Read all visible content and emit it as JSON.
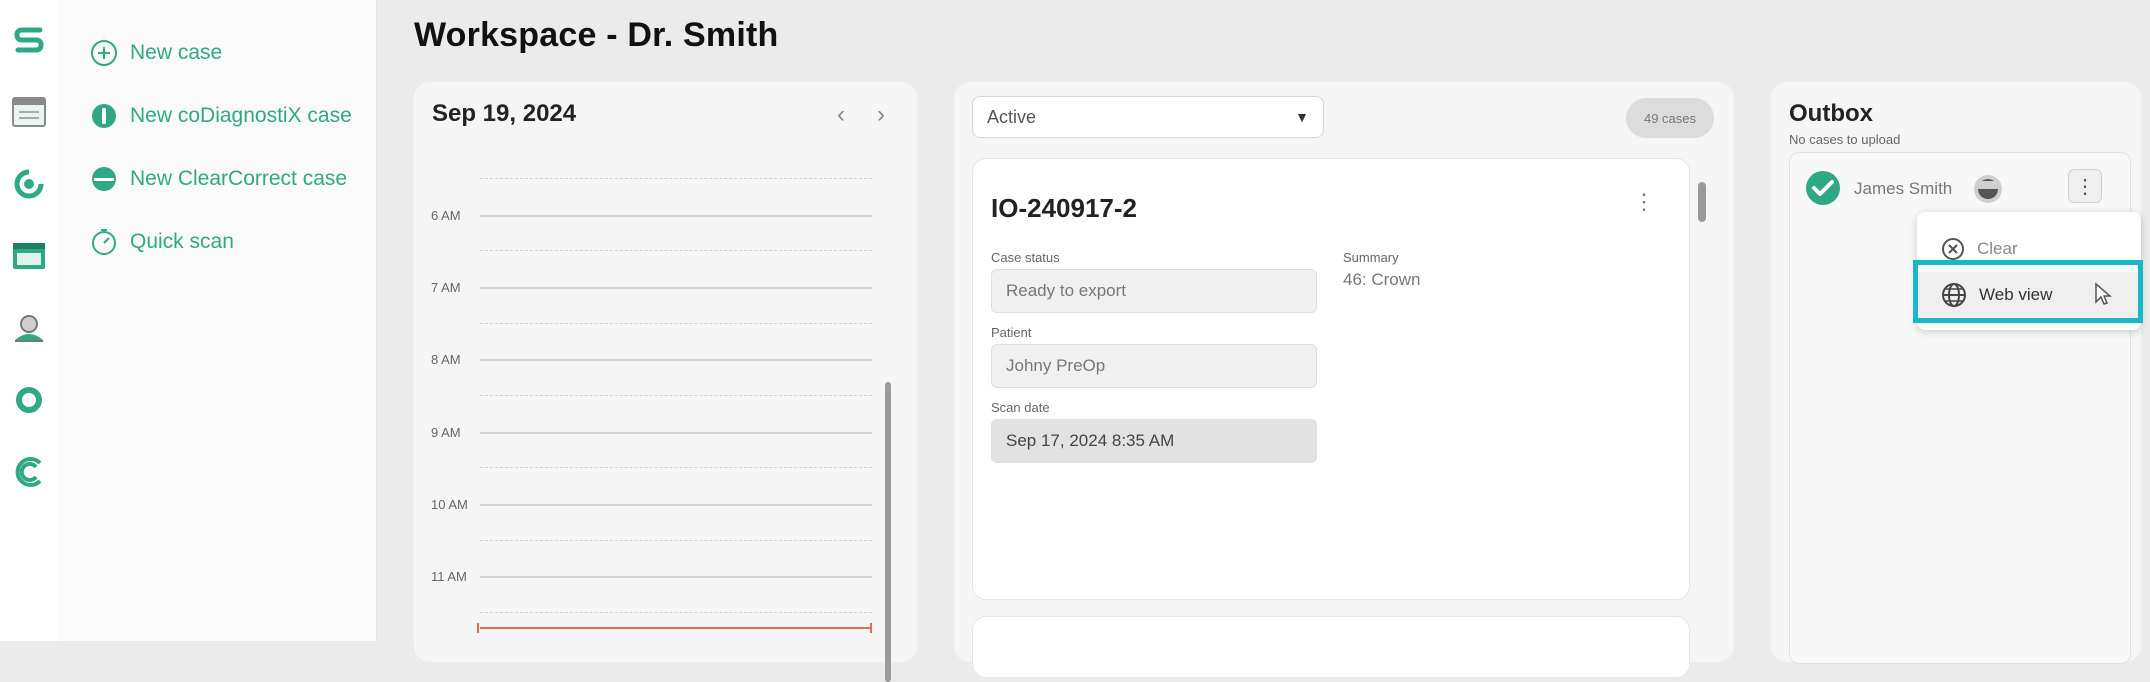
{
  "app": {
    "title": "Workspace - Dr. Smith"
  },
  "rail": {
    "items": [
      {
        "name": "home",
        "icon": "s-logo-icon"
      },
      {
        "name": "scanner",
        "icon": "scanner-icon"
      },
      {
        "name": "dental",
        "icon": "tooth-outline-icon"
      },
      {
        "name": "cases",
        "icon": "folder-icon"
      },
      {
        "name": "patients",
        "icon": "user-scan-icon"
      },
      {
        "name": "settings",
        "icon": "ring-icon"
      },
      {
        "name": "clearcorrect",
        "icon": "c-logo-icon"
      }
    ],
    "accent_color": "#2fa886"
  },
  "shortcuts": {
    "items": [
      {
        "label": "New case",
        "icon": "plus-circle-icon"
      },
      {
        "label": "New coDiagnostiX case",
        "icon": "codiagnostix-icon"
      },
      {
        "label": "New ClearCorrect case",
        "icon": "clearcorrect-icon"
      },
      {
        "label": "Quick scan",
        "icon": "timer-icon"
      }
    ]
  },
  "calendar": {
    "date": "Sep 19, 2024",
    "prev_label": "‹",
    "next_label": "›",
    "hours": [
      "6 AM",
      "7 AM",
      "8 AM",
      "9 AM",
      "10 AM",
      "11 AM"
    ],
    "now_line_color": "#e06a5c"
  },
  "cases": {
    "filter": {
      "selected": "Active"
    },
    "count": "49 cases",
    "card": {
      "id": "IO-240917-2",
      "status_label": "Case status",
      "status_value": "Ready to export",
      "patient_label": "Patient",
      "patient_value": "Johny PreOp",
      "scan_date_label": "Scan date",
      "scan_date_value": "Sep 17, 2024 8:35 AM",
      "summary_label": "Summary",
      "summary_value": "46: Crown"
    }
  },
  "outbox": {
    "title": "Outbox",
    "subtitle": "No cases to upload",
    "item": {
      "name": "James Smith",
      "status_icon": "check-circle-icon",
      "status_color": "#2fa886"
    },
    "menu": {
      "items": [
        {
          "label": "Clear",
          "icon": "close-circle-icon"
        },
        {
          "label": "Web view",
          "icon": "globe-icon"
        }
      ],
      "highlight_color": "#18b8c8"
    }
  }
}
